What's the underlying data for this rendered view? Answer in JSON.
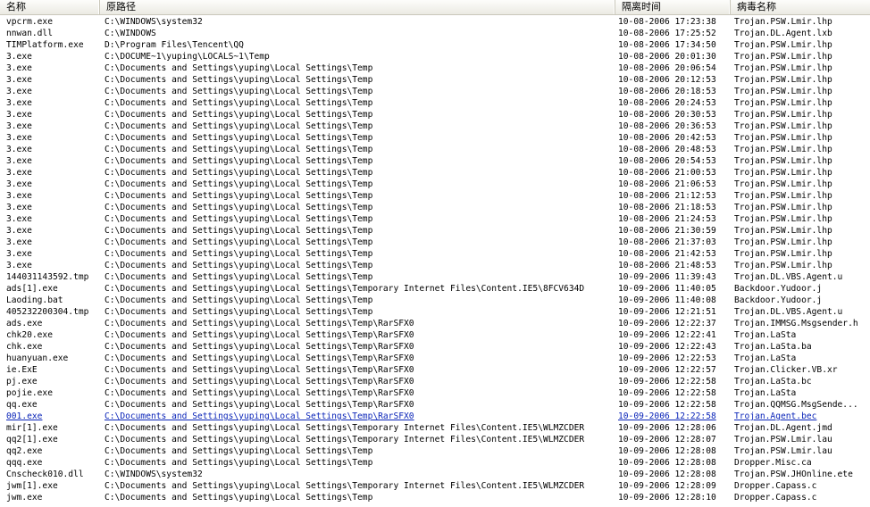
{
  "columns": [
    "名称",
    "原路径",
    "隔离时间",
    "病毒名称"
  ],
  "rows": [
    [
      "vpcrm.exe",
      "C:\\WINDOWS\\system32",
      "10-08-2006 17:23:38",
      "Trojan.PSW.Lmir.lhp"
    ],
    [
      "nnwan.dll",
      "C:\\WINDOWS",
      "10-08-2006 17:25:52",
      "Trojan.DL.Agent.lxb"
    ],
    [
      "TIMPlatform.exe",
      "D:\\Program Files\\Tencent\\QQ",
      "10-08-2006 17:34:50",
      "Trojan.PSW.Lmir.lhp"
    ],
    [
      "3.exe",
      "C:\\DOCUME~1\\yuping\\LOCALS~1\\Temp",
      "10-08-2006 20:01:30",
      "Trojan.PSW.Lmir.lhp"
    ],
    [
      "3.exe",
      "C:\\Documents and Settings\\yuping\\Local Settings\\Temp",
      "10-08-2006 20:06:54",
      "Trojan.PSW.Lmir.lhp"
    ],
    [
      "3.exe",
      "C:\\Documents and Settings\\yuping\\Local Settings\\Temp",
      "10-08-2006 20:12:53",
      "Trojan.PSW.Lmir.lhp"
    ],
    [
      "3.exe",
      "C:\\Documents and Settings\\yuping\\Local Settings\\Temp",
      "10-08-2006 20:18:53",
      "Trojan.PSW.Lmir.lhp"
    ],
    [
      "3.exe",
      "C:\\Documents and Settings\\yuping\\Local Settings\\Temp",
      "10-08-2006 20:24:53",
      "Trojan.PSW.Lmir.lhp"
    ],
    [
      "3.exe",
      "C:\\Documents and Settings\\yuping\\Local Settings\\Temp",
      "10-08-2006 20:30:53",
      "Trojan.PSW.Lmir.lhp"
    ],
    [
      "3.exe",
      "C:\\Documents and Settings\\yuping\\Local Settings\\Temp",
      "10-08-2006 20:36:53",
      "Trojan.PSW.Lmir.lhp"
    ],
    [
      "3.exe",
      "C:\\Documents and Settings\\yuping\\Local Settings\\Temp",
      "10-08-2006 20:42:53",
      "Trojan.PSW.Lmir.lhp"
    ],
    [
      "3.exe",
      "C:\\Documents and Settings\\yuping\\Local Settings\\Temp",
      "10-08-2006 20:48:53",
      "Trojan.PSW.Lmir.lhp"
    ],
    [
      "3.exe",
      "C:\\Documents and Settings\\yuping\\Local Settings\\Temp",
      "10-08-2006 20:54:53",
      "Trojan.PSW.Lmir.lhp"
    ],
    [
      "3.exe",
      "C:\\Documents and Settings\\yuping\\Local Settings\\Temp",
      "10-08-2006 21:00:53",
      "Trojan.PSW.Lmir.lhp"
    ],
    [
      "3.exe",
      "C:\\Documents and Settings\\yuping\\Local Settings\\Temp",
      "10-08-2006 21:06:53",
      "Trojan.PSW.Lmir.lhp"
    ],
    [
      "3.exe",
      "C:\\Documents and Settings\\yuping\\Local Settings\\Temp",
      "10-08-2006 21:12:53",
      "Trojan.PSW.Lmir.lhp"
    ],
    [
      "3.exe",
      "C:\\Documents and Settings\\yuping\\Local Settings\\Temp",
      "10-08-2006 21:18:53",
      "Trojan.PSW.Lmir.lhp"
    ],
    [
      "3.exe",
      "C:\\Documents and Settings\\yuping\\Local Settings\\Temp",
      "10-08-2006 21:24:53",
      "Trojan.PSW.Lmir.lhp"
    ],
    [
      "3.exe",
      "C:\\Documents and Settings\\yuping\\Local Settings\\Temp",
      "10-08-2006 21:30:59",
      "Trojan.PSW.Lmir.lhp"
    ],
    [
      "3.exe",
      "C:\\Documents and Settings\\yuping\\Local Settings\\Temp",
      "10-08-2006 21:37:03",
      "Trojan.PSW.Lmir.lhp"
    ],
    [
      "3.exe",
      "C:\\Documents and Settings\\yuping\\Local Settings\\Temp",
      "10-08-2006 21:42:53",
      "Trojan.PSW.Lmir.lhp"
    ],
    [
      "3.exe",
      "C:\\Documents and Settings\\yuping\\Local Settings\\Temp",
      "10-08-2006 21:48:53",
      "Trojan.PSW.Lmir.lhp"
    ],
    [
      "144031143592.tmp",
      "C:\\Documents and Settings\\yuping\\Local Settings\\Temp",
      "10-09-2006 11:39:43",
      "Trojan.DL.VBS.Agent.u"
    ],
    [
      "ads[1].exe",
      "C:\\Documents and Settings\\yuping\\Local Settings\\Temporary Internet Files\\Content.IE5\\8FCV634D",
      "10-09-2006 11:40:05",
      "Backdoor.Yudoor.j"
    ],
    [
      "Laoding.bat",
      "C:\\Documents and Settings\\yuping\\Local Settings\\Temp",
      "10-09-2006 11:40:08",
      "Backdoor.Yudoor.j"
    ],
    [
      "405232200304.tmp",
      "C:\\Documents and Settings\\yuping\\Local Settings\\Temp",
      "10-09-2006 12:21:51",
      "Trojan.DL.VBS.Agent.u"
    ],
    [
      "ads.exe",
      "C:\\Documents and Settings\\yuping\\Local Settings\\Temp\\RarSFX0",
      "10-09-2006 12:22:37",
      "Trojan.IMMSG.Msgsender.h"
    ],
    [
      "chk20.exe",
      "C:\\Documents and Settings\\yuping\\Local Settings\\Temp\\RarSFX0",
      "10-09-2006 12:22:41",
      "Trojan.LaSta"
    ],
    [
      "chk.exe",
      "C:\\Documents and Settings\\yuping\\Local Settings\\Temp\\RarSFX0",
      "10-09-2006 12:22:43",
      "Trojan.LaSta.ba"
    ],
    [
      "huanyuan.exe",
      "C:\\Documents and Settings\\yuping\\Local Settings\\Temp\\RarSFX0",
      "10-09-2006 12:22:53",
      "Trojan.LaSta"
    ],
    [
      "ie.ExE",
      "C:\\Documents and Settings\\yuping\\Local Settings\\Temp\\RarSFX0",
      "10-09-2006 12:22:57",
      "Trojan.Clicker.VB.xr"
    ],
    [
      "pj.exe",
      "C:\\Documents and Settings\\yuping\\Local Settings\\Temp\\RarSFX0",
      "10-09-2006 12:22:58",
      "Trojan.LaSta.bc"
    ],
    [
      "pojie.exe",
      "C:\\Documents and Settings\\yuping\\Local Settings\\Temp\\RarSFX0",
      "10-09-2006 12:22:58",
      "Trojan.LaSta"
    ],
    [
      "qq.exe",
      "C:\\Documents and Settings\\yuping\\Local Settings\\Temp\\RarSFX0",
      "10-09-2006 12:22:58",
      "Trojan.QQMSG.MsgSende..."
    ],
    [
      "001.exe",
      "C:\\Documents and Settings\\yuping\\Local Settings\\Temp\\RarSFX0",
      "10-09-2006 12:22:58",
      "Trojan.Agent.bec"
    ],
    [
      "mir[1].exe",
      "C:\\Documents and Settings\\yuping\\Local Settings\\Temporary Internet Files\\Content.IE5\\WLMZCDER",
      "10-09-2006 12:28:06",
      "Trojan.DL.Agent.jmd"
    ],
    [
      "qq2[1].exe",
      "C:\\Documents and Settings\\yuping\\Local Settings\\Temporary Internet Files\\Content.IE5\\WLMZCDER",
      "10-09-2006 12:28:07",
      "Trojan.PSW.Lmir.lau"
    ],
    [
      "qq2.exe",
      "C:\\Documents and Settings\\yuping\\Local Settings\\Temp",
      "10-09-2006 12:28:08",
      "Trojan.PSW.Lmir.lau"
    ],
    [
      "qqq.exe",
      "C:\\Documents and Settings\\yuping\\Local Settings\\Temp",
      "10-09-2006 12:28:08",
      "Dropper.Misc.ca"
    ],
    [
      "Cnscheck010.dll",
      "C:\\WINDOWS\\system32",
      "10-09-2006 12:28:08",
      "Trojan.PSW.JHOnline.ete"
    ],
    [
      "jwm[1].exe",
      "C:\\Documents and Settings\\yuping\\Local Settings\\Temporary Internet Files\\Content.IE5\\WLMZCDER",
      "10-09-2006 12:28:09",
      "Dropper.Capass.c"
    ],
    [
      "jwm.exe",
      "C:\\Documents and Settings\\yuping\\Local Settings\\Temp",
      "10-09-2006 12:28:10",
      "Dropper.Capass.c"
    ]
  ],
  "highlighted_row": 34,
  "colors": {
    "highlight_text": "#0a24b8",
    "header_border": "#c9c7ba"
  }
}
